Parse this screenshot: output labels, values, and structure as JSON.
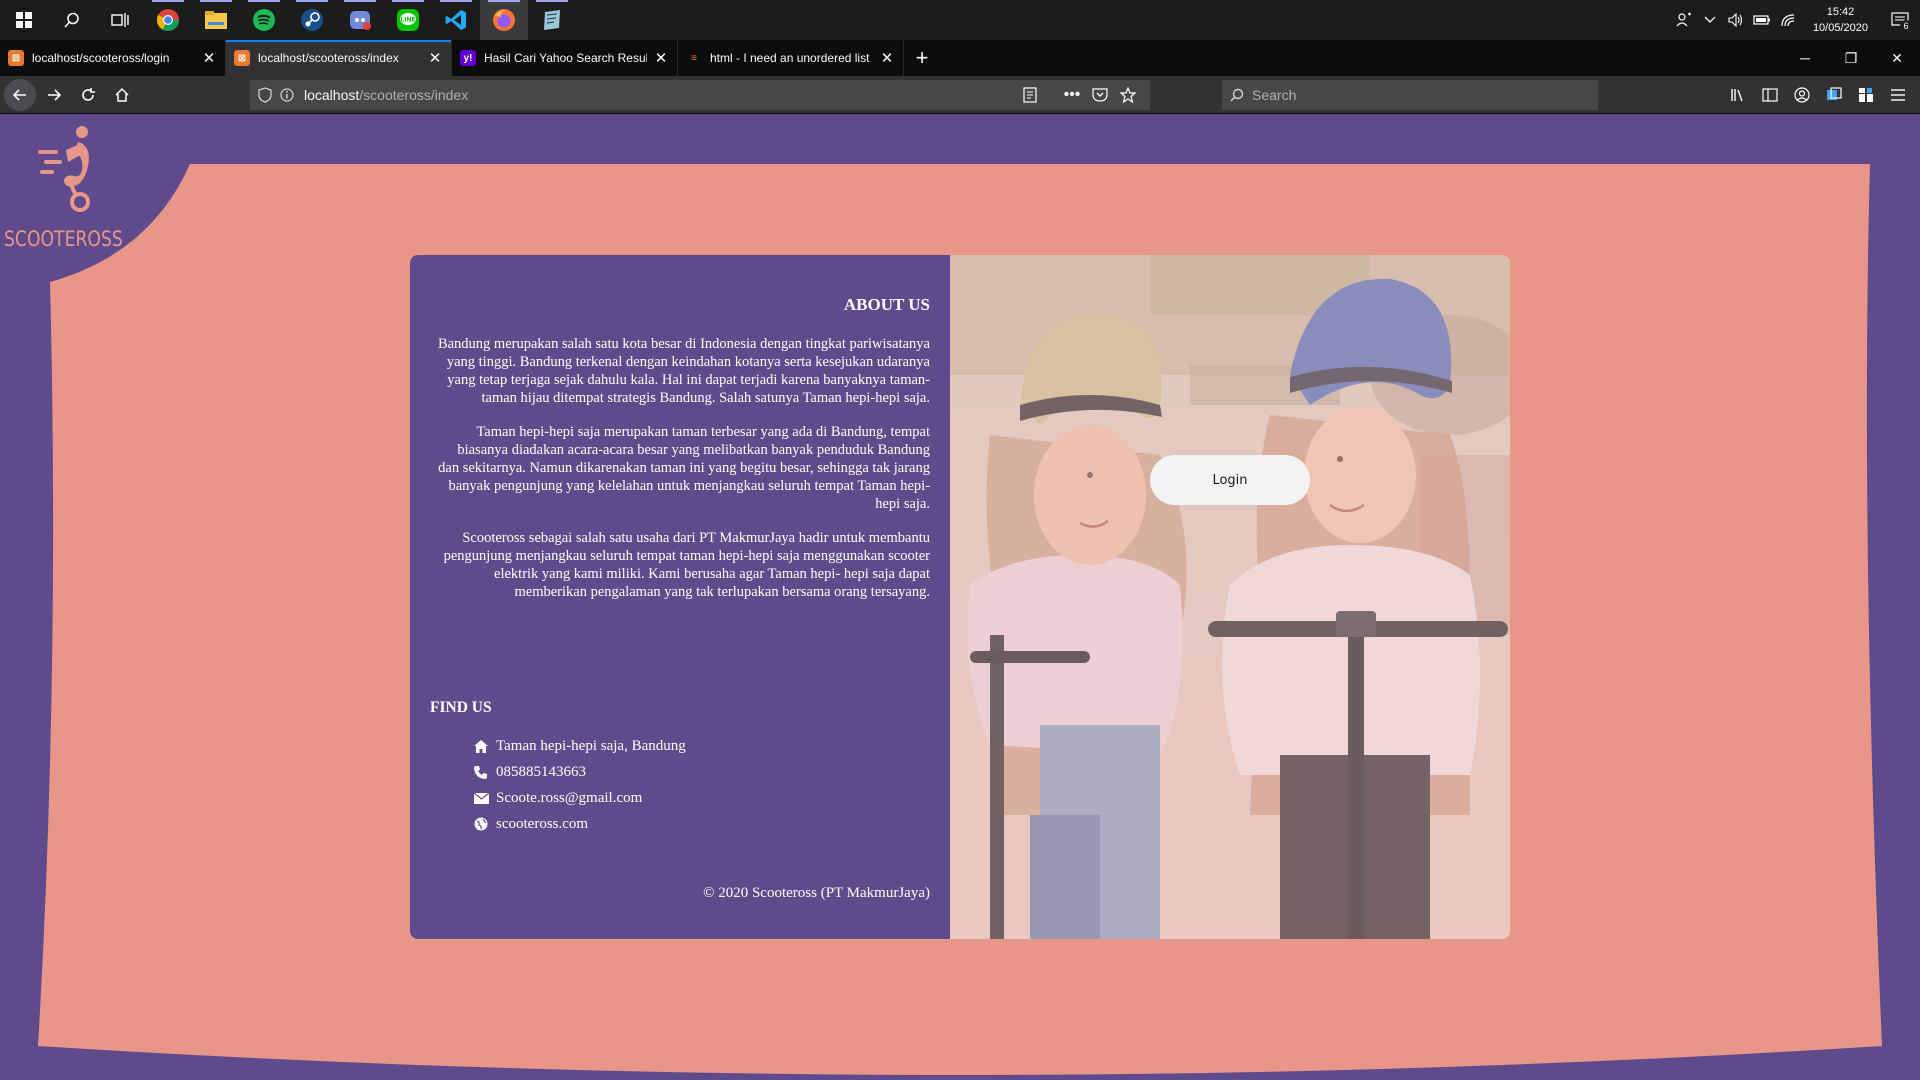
{
  "taskbar": {
    "apps": [
      {
        "name": "start",
        "icon": "windows-logo-icon"
      },
      {
        "name": "search",
        "icon": "search-icon"
      },
      {
        "name": "task-view",
        "icon": "task-view-icon"
      },
      {
        "name": "chrome",
        "icon": "chrome-icon"
      },
      {
        "name": "file-explorer",
        "icon": "folder-icon"
      },
      {
        "name": "spotify",
        "icon": "spotify-icon"
      },
      {
        "name": "steam",
        "icon": "steam-icon"
      },
      {
        "name": "discord",
        "icon": "discord-icon"
      },
      {
        "name": "line",
        "icon": "line-icon"
      },
      {
        "name": "vscode",
        "icon": "vscode-icon"
      },
      {
        "name": "firefox",
        "icon": "firefox-icon"
      },
      {
        "name": "notes",
        "icon": "notes-icon"
      }
    ],
    "time": "15:42",
    "date": "10/05/2020",
    "notification_count": "6"
  },
  "tabs": [
    {
      "title": "localhost/scooteross/login",
      "favicon_color": "#e8792f"
    },
    {
      "title": "localhost/scooteross/index",
      "favicon_color": "#e8792f"
    },
    {
      "title": "Hasil Cari Yahoo Search Results",
      "favicon_color": "#6001d2"
    },
    {
      "title": "html - I need an unordered list",
      "favicon_color": "#f48024"
    }
  ],
  "urlbar": {
    "host": "localhost",
    "path": "/scooteross/index"
  },
  "search": {
    "placeholder": "Search"
  },
  "page": {
    "brand": "SCOOTEROSS",
    "colors": {
      "purple": "#5f4b8b",
      "salmon": "#e8968a"
    },
    "about": {
      "title": "ABOUT US",
      "paragraphs": [
        "Bandung merupakan salah satu kota besar di Indonesia dengan tingkat pariwisatanya yang tinggi. Bandung terkenal dengan keindahan kotanya serta kesejukan udaranya yang tetap terjaga sejak dahulu kala. Hal ini dapat terjadi karena banyaknya taman-taman hijau ditempat strategis Bandung. Salah satunya Taman hepi-hepi saja.",
        "Taman hepi-hepi saja merupakan taman terbesar yang ada di Bandung, tempat biasanya diadakan acara-acara besar yang melibatkan banyak penduduk Bandung dan sekitarnya. Namun dikarenakan taman ini yang begitu besar, sehingga tak jarang banyak pengunjung yang kelelahan untuk menjangkau seluruh tempat Taman hepi-hepi saja.",
        "Scooteross sebagai salah satu usaha dari PT MakmurJaya hadir untuk membantu pengunjung menjangkau seluruh tempat taman hepi-hepi saja menggunakan scooter elektrik yang kami miliki. Kami berusaha agar Taman hepi- hepi saja dapat memberikan pengalaman yang tak terlupakan bersama orang tersayang."
      ]
    },
    "find_us": {
      "title": "FIND US",
      "address": "Taman hepi-hepi saja, Bandung",
      "phone": "085885143663",
      "email": "Scoote.ross@gmail.com",
      "website": "scooteross.com"
    },
    "copyright": "© 2020 Scooteross (PT MakmurJaya)",
    "login_label": "Login"
  }
}
